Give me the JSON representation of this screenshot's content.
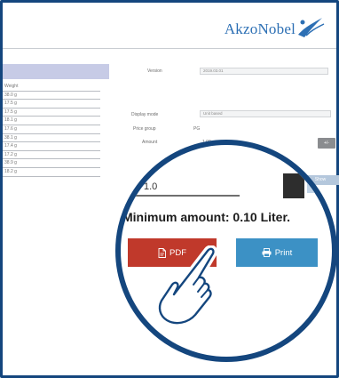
{
  "header": {
    "brand_name": "AkzoNobel"
  },
  "sidebar": {
    "rows": [
      "Weight",
      "38.0 g",
      "17.5 g",
      "17.5 g",
      "18.1 g",
      "17.6 g",
      "38.1 g",
      "17.4 g",
      "17.2 g",
      "38.9 g",
      "18.2 g"
    ]
  },
  "form": {
    "version_label": "Version",
    "version_value": "2019.03.01",
    "display_mode_label": "Display mode",
    "display_mode_value": "Unit based",
    "price_group_label": "Price group",
    "price_group_value": "PG",
    "amount_label": "Amount",
    "amount_value": "1.00",
    "small_button_label": "+/-",
    "light_button_label": "Show"
  },
  "magnified": {
    "amount_input_value": "1.0",
    "minimum_amount_text": "Minimum amount: 0.10 Liter.",
    "pdf_button_label": "PDF",
    "print_button_label": "Print"
  },
  "colors": {
    "frame": "#14467e",
    "brand": "#2c6fb4",
    "pdf_button": "#c0392b",
    "print_button": "#3c91c5",
    "sidebar_header": "#c7cbe6"
  },
  "icons": {
    "pdf": "pdf-file-icon",
    "print": "printer-icon",
    "pointer": "pointing-hand-icon",
    "logo": "akzonobel-logo-icon"
  }
}
